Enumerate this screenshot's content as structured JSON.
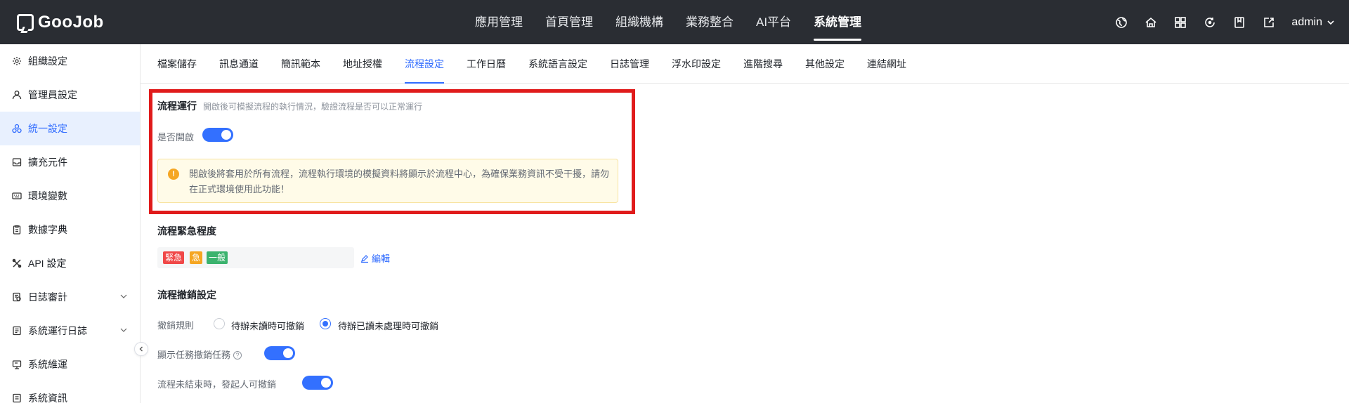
{
  "app": {
    "logo_text": "GooJob"
  },
  "topnav": [
    {
      "label": "應用管理",
      "active": false
    },
    {
      "label": "首頁管理",
      "active": false
    },
    {
      "label": "組織機構",
      "active": false
    },
    {
      "label": "業務整合",
      "active": false
    },
    {
      "label": "AI平台",
      "active": false
    },
    {
      "label": "系統管理",
      "active": true
    }
  ],
  "topbar": {
    "icons": [
      "globe-icon",
      "home-icon",
      "grid-icon",
      "refresh-icon",
      "book-icon",
      "export-icon"
    ],
    "user": "admin"
  },
  "sidebar": {
    "items": [
      {
        "label": "組織設定",
        "icon": "gear-icon",
        "active": false,
        "expandable": false
      },
      {
        "label": "管理員設定",
        "icon": "user-icon",
        "active": false,
        "expandable": false
      },
      {
        "label": "統一設定",
        "icon": "settings-cluster-icon",
        "active": true,
        "expandable": false
      },
      {
        "label": "擴充元件",
        "icon": "inbox-icon",
        "active": false,
        "expandable": false
      },
      {
        "label": "環境變數",
        "icon": "keyboard-icon",
        "active": false,
        "expandable": false
      },
      {
        "label": "數據字典",
        "icon": "clipboard-icon",
        "active": false,
        "expandable": false
      },
      {
        "label": "API 設定",
        "icon": "tools-icon",
        "active": false,
        "expandable": false
      },
      {
        "label": "日誌審計",
        "icon": "audit-icon",
        "active": false,
        "expandable": true
      },
      {
        "label": "系統運行日誌",
        "icon": "log-icon",
        "active": false,
        "expandable": true
      },
      {
        "label": "系統維運",
        "icon": "maintenance-icon",
        "active": false,
        "expandable": false
      },
      {
        "label": "系統資訊",
        "icon": "info-icon",
        "active": false,
        "expandable": false
      }
    ]
  },
  "tabs": [
    {
      "label": "檔案儲存",
      "active": false
    },
    {
      "label": "訊息通道",
      "active": false
    },
    {
      "label": "簡訊範本",
      "active": false
    },
    {
      "label": "地址授權",
      "active": false
    },
    {
      "label": "流程設定",
      "active": true
    },
    {
      "label": "工作日曆",
      "active": false
    },
    {
      "label": "系統語言設定",
      "active": false
    },
    {
      "label": "日誌管理",
      "active": false
    },
    {
      "label": "浮水印設定",
      "active": false
    },
    {
      "label": "進階搜尋",
      "active": false
    },
    {
      "label": "其他設定",
      "active": false
    },
    {
      "label": "連結網址",
      "active": false
    }
  ],
  "flow_run": {
    "title": "流程運行",
    "desc": "開啟後可模擬流程的執行情況，驗證流程是否可以正常運行",
    "toggle_label": "是否開啟",
    "enabled": true,
    "alert": "開啟後將套用於所有流程，流程執行環境的模擬資料將顯示於流程中心，為確保業務資訊不受干擾，請勿在正式環境使用此功能！"
  },
  "urgency": {
    "title": "流程緊急程度",
    "tags": [
      {
        "label": "緊急",
        "color": "#f04848"
      },
      {
        "label": "急",
        "color": "#f5a623"
      },
      {
        "label": "一般",
        "color": "#3bb36e"
      }
    ],
    "edit_label": "編輯"
  },
  "revoke": {
    "title": "流程撤銷設定",
    "rule_label": "撤銷規則",
    "options": [
      {
        "label": "待辦未讀時可撤銷",
        "checked": false
      },
      {
        "label": "待辦已讀未處理時可撤銷",
        "checked": true
      }
    ],
    "show_task_label": "顯示任務撤銷任務",
    "show_task_enabled": true,
    "initiator_label": "流程未結束時，發起人可撤銷",
    "initiator_enabled": true
  },
  "colors": {
    "accent": "#3370ff",
    "topbar": "#2a2d33",
    "highlight": "#e01b1b"
  }
}
